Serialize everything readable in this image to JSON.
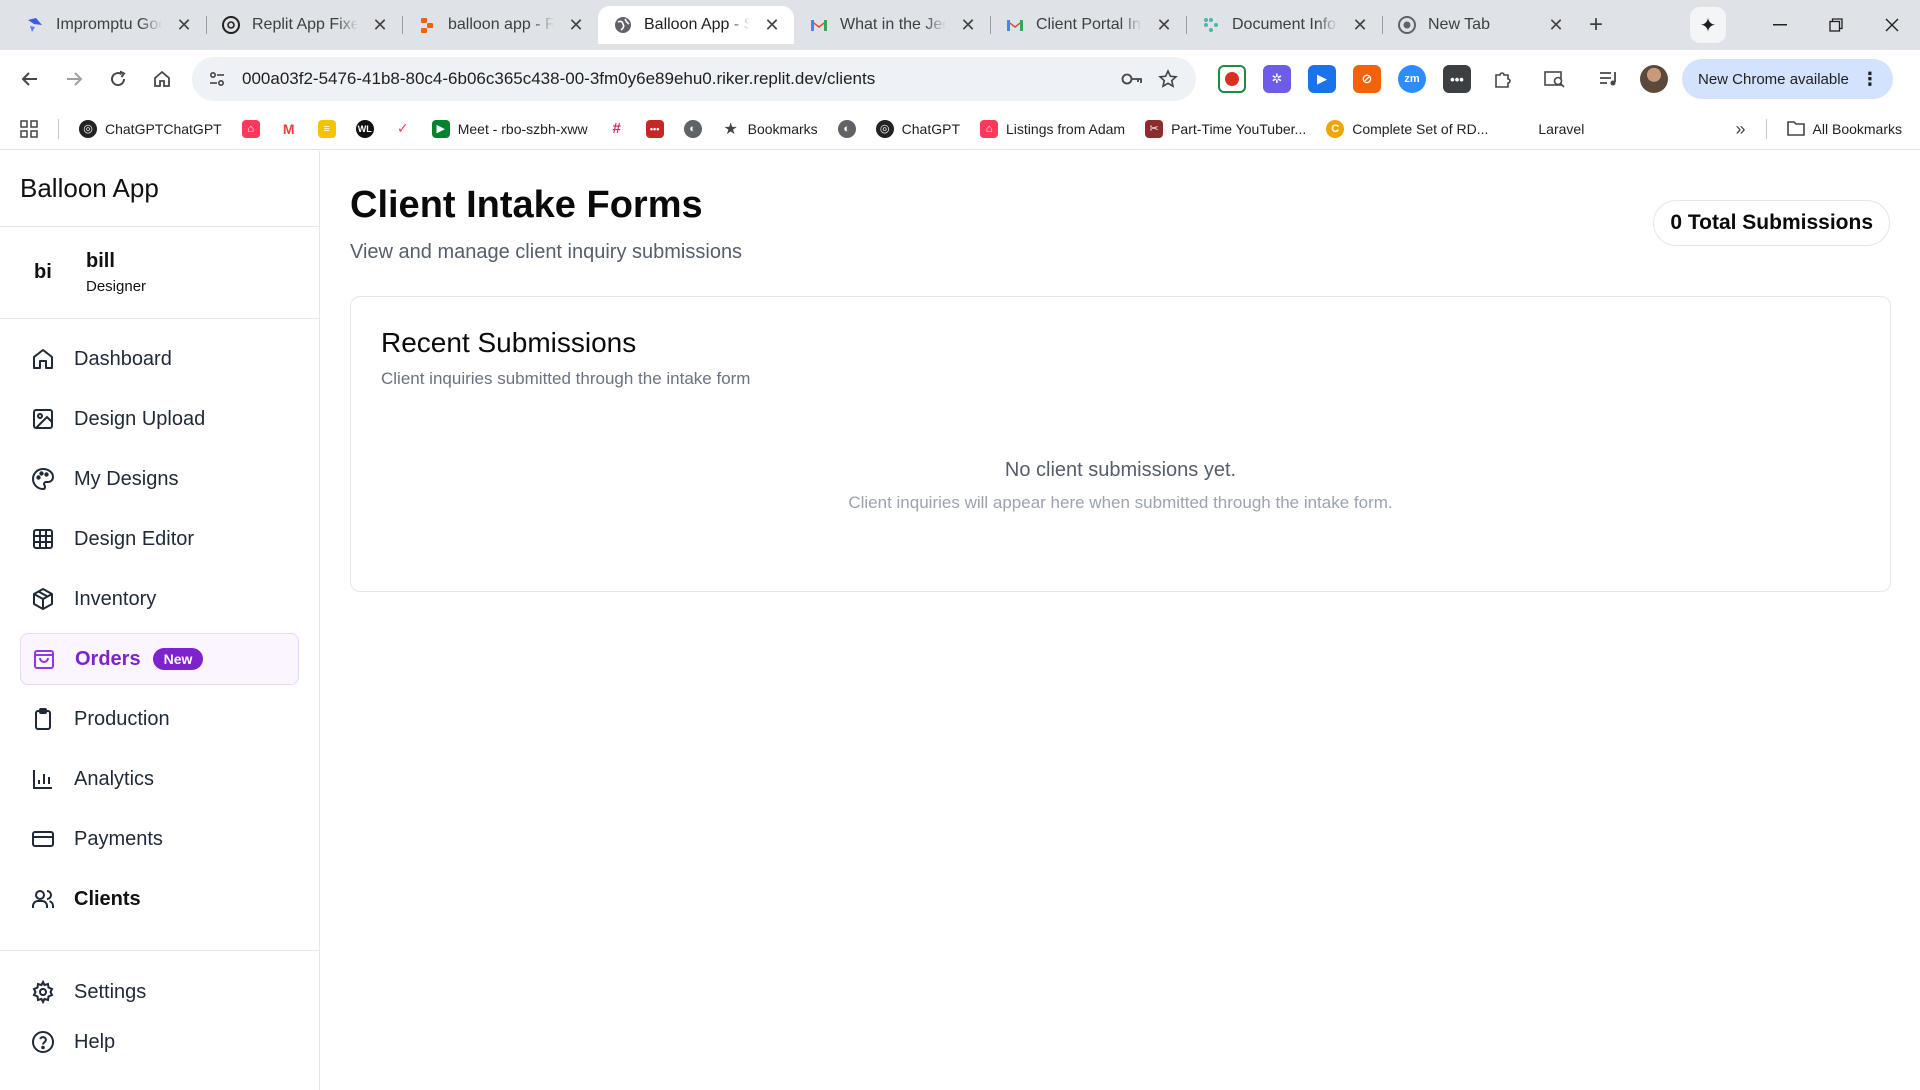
{
  "browser": {
    "tabs": [
      {
        "title": "Impromptu Goo",
        "icon": "impromptu-icon",
        "active": false
      },
      {
        "title": "Replit App Fixes",
        "icon": "chatgpt-icon",
        "active": false
      },
      {
        "title": "balloon app - Re",
        "icon": "replit-icon",
        "active": false
      },
      {
        "title": "Balloon App - St",
        "icon": "globe-icon",
        "active": true
      },
      {
        "title": "What in the Jedi",
        "icon": "gmail-icon",
        "active": false
      },
      {
        "title": "Client Portal Inv",
        "icon": "gmail-icon",
        "active": false
      },
      {
        "title": "Document Infor",
        "icon": "document-icon",
        "active": false
      },
      {
        "title": "New Tab",
        "icon": "chrome-icon",
        "active": false
      }
    ],
    "url": "000a03f2-5476-41b8-80c4-6b06c365c438-00-3fm0y6e89ehu0.riker.replit.dev/clients",
    "update_label": "New Chrome available",
    "bookmarks": [
      {
        "label": "ChatGPTChatGPT",
        "icon": "chatgpt-icon"
      },
      {
        "label": "",
        "icon": "airbnb-icon"
      },
      {
        "label": "",
        "icon": "gmail-icon"
      },
      {
        "label": "",
        "icon": "yellow-app-icon"
      },
      {
        "label": "",
        "icon": "wl-icon"
      },
      {
        "label": "",
        "icon": "monday-icon"
      },
      {
        "label": "Meet - rbo-szbh-xww",
        "icon": "meet-icon"
      },
      {
        "label": "",
        "icon": "slack-icon"
      },
      {
        "label": "",
        "icon": "red-app-icon"
      },
      {
        "label": "",
        "icon": "globe-icon"
      },
      {
        "label": "Bookmarks",
        "icon": "star-icon"
      },
      {
        "label": "",
        "icon": "globe-icon"
      },
      {
        "label": "ChatGPT",
        "icon": "chatgpt-icon"
      },
      {
        "label": "Listings from Adam",
        "icon": "airbnb-icon"
      },
      {
        "label": "Part-Time YouTuber...",
        "icon": "clapper-icon"
      },
      {
        "label": "Complete Set of RD...",
        "icon": "orange-app-icon"
      },
      {
        "label": "Laravel",
        "icon": ""
      }
    ],
    "all_bookmarks_label": "All Bookmarks"
  },
  "app": {
    "brand": "Balloon App",
    "user": {
      "initials": "bi",
      "name": "bill",
      "role": "Designer"
    },
    "nav": [
      {
        "label": "Dashboard",
        "icon": "home-icon"
      },
      {
        "label": "Design Upload",
        "icon": "image-icon"
      },
      {
        "label": "My Designs",
        "icon": "palette-icon"
      },
      {
        "label": "Design Editor",
        "icon": "grid-icon"
      },
      {
        "label": "Inventory",
        "icon": "box-icon"
      },
      {
        "label": "Orders",
        "icon": "shopping-bag-icon",
        "badge": "New"
      },
      {
        "label": "Production",
        "icon": "clipboard-icon"
      },
      {
        "label": "Analytics",
        "icon": "bar-chart-icon"
      },
      {
        "label": "Payments",
        "icon": "credit-card-icon"
      },
      {
        "label": "Clients",
        "icon": "users-icon"
      }
    ],
    "nav_bottom": [
      {
        "label": "Settings",
        "icon": "gear-icon"
      },
      {
        "label": "Help",
        "icon": "help-circle-icon"
      }
    ],
    "page": {
      "title": "Client Intake Forms",
      "subtitle": "View and manage client inquiry submissions",
      "total_label": "0 Total Submissions",
      "card": {
        "title": "Recent Submissions",
        "subtitle": "Client inquiries submitted through the intake form",
        "empty_title": "No client submissions yet.",
        "empty_subtitle": "Client inquiries will appear here when submitted through the intake form."
      }
    }
  },
  "colors": {
    "accent_purple": "#7e22ce",
    "active_bg": "#faf5ff",
    "tabstrip_bg": "#dfe3e7"
  }
}
